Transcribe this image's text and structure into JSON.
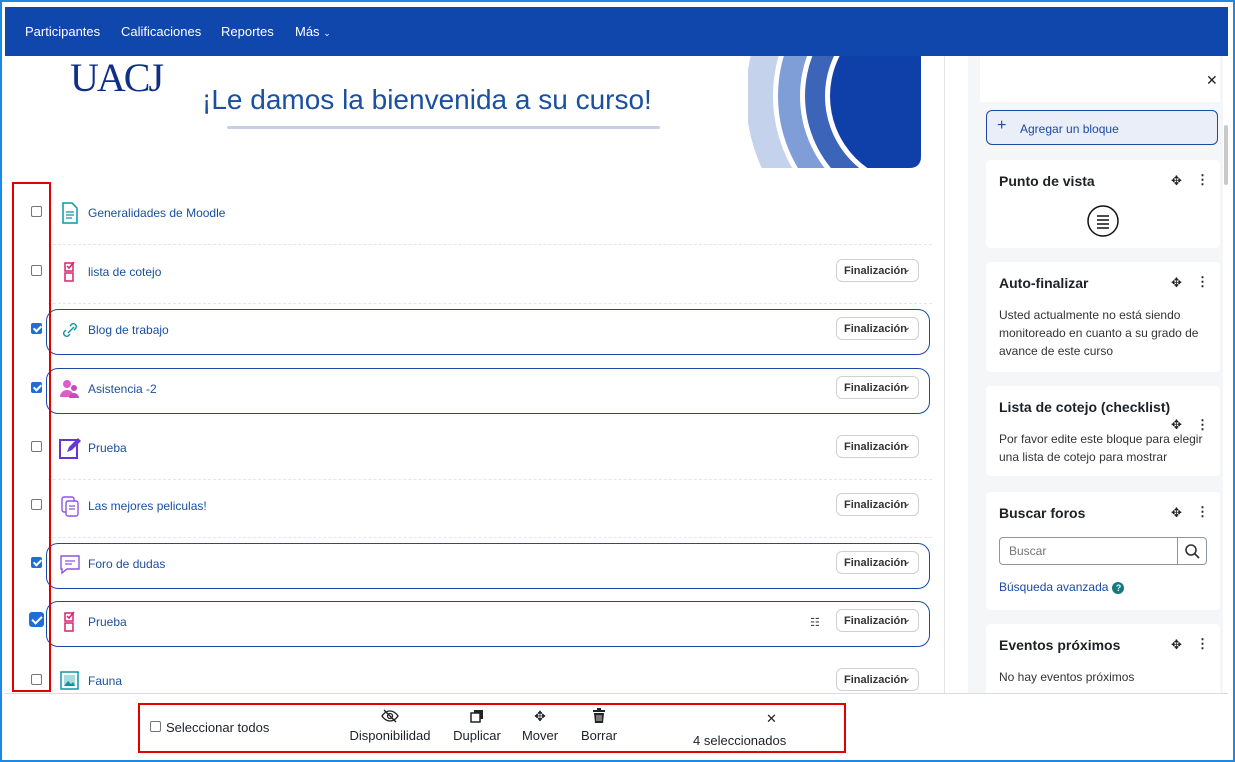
{
  "nav": {
    "items": [
      "Participantes",
      "Calificaciones",
      "Reportes",
      "Más"
    ]
  },
  "banner": {
    "logo_text": "UACJ",
    "welcome": "¡Le damos la bienvenida a su curso!"
  },
  "activities": [
    {
      "name": "Generalidades de Moodle",
      "icon": "page-icon",
      "checked": false,
      "finalizacion": false
    },
    {
      "name": "lista de cotejo",
      "icon": "checklist-icon",
      "checked": false,
      "finalizacion": true
    },
    {
      "name": "Blog de trabajo",
      "icon": "link-icon",
      "checked": true,
      "finalizacion": true
    },
    {
      "name": "Asistencia -2",
      "icon": "attendance-icon",
      "checked": true,
      "finalizacion": true
    },
    {
      "name": "Prueba",
      "icon": "assignment-icon",
      "checked": false,
      "finalizacion": true
    },
    {
      "name": "Las mejores peliculas!",
      "icon": "glossary-icon",
      "checked": false,
      "finalizacion": true
    },
    {
      "name": "Foro de dudas",
      "icon": "forum-icon",
      "checked": true,
      "finalizacion": true
    },
    {
      "name": "Prueba",
      "icon": "checklist-icon",
      "checked": true,
      "finalizacion": true
    },
    {
      "name": "Fauna",
      "icon": "image-icon",
      "checked": false,
      "finalizacion": true
    }
  ],
  "finalizacion_label": "Finalización",
  "sidebar": {
    "add_block": "Agregar un bloque",
    "blocks": {
      "punto": {
        "title": "Punto de vista"
      },
      "auto": {
        "title": "Auto-finalizar",
        "text": "Usted actualmente no está siendo monitoreado en cuanto a su grado de avance de este curso"
      },
      "lista": {
        "title": "Lista de cotejo (checklist)",
        "text": "Por favor edite este bloque para elegir una lista de cotejo para mostrar"
      },
      "foros": {
        "title": "Buscar foros",
        "search_placeholder": "Buscar",
        "advanced": "Búsqueda avanzada"
      },
      "eventos": {
        "title": "Eventos próximos",
        "text": "No hay eventos próximos"
      }
    }
  },
  "bulk": {
    "select_all": "Seleccionar todos",
    "disponibilidad": "Disponibilidad",
    "duplicar": "Duplicar",
    "mover": "Mover",
    "borrar": "Borrar",
    "count": "4 seleccionados"
  },
  "colors": {
    "nav": "#0f47ad",
    "link": "#1b4fa0",
    "highlight": "#e00000"
  }
}
